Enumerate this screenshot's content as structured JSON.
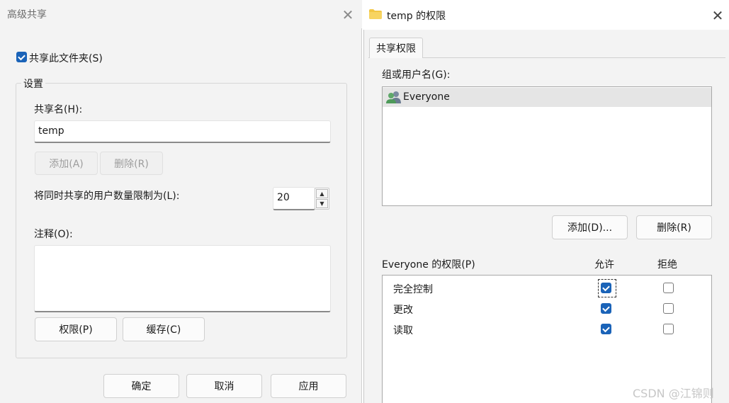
{
  "advanced_sharing": {
    "title": "高级共享",
    "share_checkbox": {
      "label": "共享此文件夹(S)",
      "checked": true
    },
    "settings": {
      "legend": "设置",
      "share_name_label": "共享名(H):",
      "share_name_value": "temp",
      "add_button": "添加(A)",
      "remove_button": "删除(R)",
      "limit_label": "将同时共享的用户数量限制为(L):",
      "limit_value": "20",
      "comment_label": "注释(O):",
      "permissions_button": "权限(P)",
      "caching_button": "缓存(C)"
    },
    "footer": {
      "ok": "确定",
      "cancel": "取消",
      "apply": "应用"
    }
  },
  "permissions_dialog": {
    "title": "temp 的权限",
    "tab": "共享权限",
    "group_label": "组或用户名(G):",
    "groups": [
      {
        "name": "Everyone",
        "icon": "users-icon",
        "selected": true
      }
    ],
    "add_button": "添加(D)...",
    "remove_button": "删除(R)",
    "permissions_header": "Everyone 的权限(P)",
    "allow_header": "允许",
    "deny_header": "拒绝",
    "permissions": [
      {
        "name": "完全控制",
        "allow": true,
        "deny": false
      },
      {
        "name": "更改",
        "allow": true,
        "deny": false
      },
      {
        "name": "读取",
        "allow": true,
        "deny": false
      }
    ]
  },
  "watermark": "CSDN @江锦则",
  "colors": {
    "accent": "#1a63b8",
    "folder": "#f2c744"
  }
}
